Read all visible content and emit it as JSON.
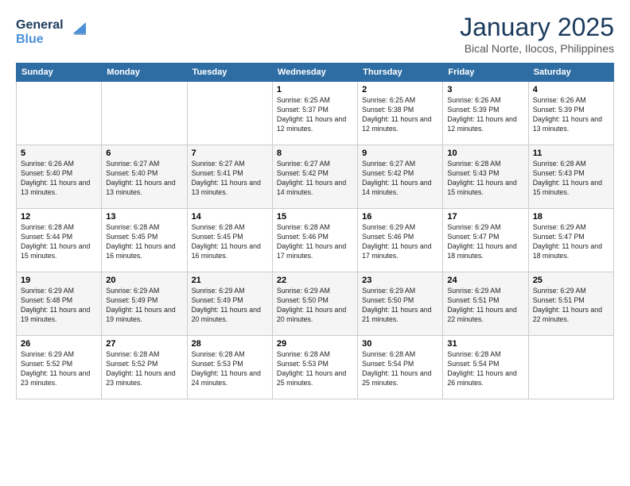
{
  "header": {
    "logo_line1": "General",
    "logo_line2": "Blue",
    "month": "January 2025",
    "location": "Bical Norte, Ilocos, Philippines"
  },
  "weekdays": [
    "Sunday",
    "Monday",
    "Tuesday",
    "Wednesday",
    "Thursday",
    "Friday",
    "Saturday"
  ],
  "weeks": [
    [
      {
        "day": "",
        "sunrise": "",
        "sunset": "",
        "daylight": ""
      },
      {
        "day": "",
        "sunrise": "",
        "sunset": "",
        "daylight": ""
      },
      {
        "day": "",
        "sunrise": "",
        "sunset": "",
        "daylight": ""
      },
      {
        "day": "1",
        "sunrise": "Sunrise: 6:25 AM",
        "sunset": "Sunset: 5:37 PM",
        "daylight": "Daylight: 11 hours and 12 minutes."
      },
      {
        "day": "2",
        "sunrise": "Sunrise: 6:25 AM",
        "sunset": "Sunset: 5:38 PM",
        "daylight": "Daylight: 11 hours and 12 minutes."
      },
      {
        "day": "3",
        "sunrise": "Sunrise: 6:26 AM",
        "sunset": "Sunset: 5:39 PM",
        "daylight": "Daylight: 11 hours and 12 minutes."
      },
      {
        "day": "4",
        "sunrise": "Sunrise: 6:26 AM",
        "sunset": "Sunset: 5:39 PM",
        "daylight": "Daylight: 11 hours and 13 minutes."
      }
    ],
    [
      {
        "day": "5",
        "sunrise": "Sunrise: 6:26 AM",
        "sunset": "Sunset: 5:40 PM",
        "daylight": "Daylight: 11 hours and 13 minutes."
      },
      {
        "day": "6",
        "sunrise": "Sunrise: 6:27 AM",
        "sunset": "Sunset: 5:40 PM",
        "daylight": "Daylight: 11 hours and 13 minutes."
      },
      {
        "day": "7",
        "sunrise": "Sunrise: 6:27 AM",
        "sunset": "Sunset: 5:41 PM",
        "daylight": "Daylight: 11 hours and 13 minutes."
      },
      {
        "day": "8",
        "sunrise": "Sunrise: 6:27 AM",
        "sunset": "Sunset: 5:42 PM",
        "daylight": "Daylight: 11 hours and 14 minutes."
      },
      {
        "day": "9",
        "sunrise": "Sunrise: 6:27 AM",
        "sunset": "Sunset: 5:42 PM",
        "daylight": "Daylight: 11 hours and 14 minutes."
      },
      {
        "day": "10",
        "sunrise": "Sunrise: 6:28 AM",
        "sunset": "Sunset: 5:43 PM",
        "daylight": "Daylight: 11 hours and 15 minutes."
      },
      {
        "day": "11",
        "sunrise": "Sunrise: 6:28 AM",
        "sunset": "Sunset: 5:43 PM",
        "daylight": "Daylight: 11 hours and 15 minutes."
      }
    ],
    [
      {
        "day": "12",
        "sunrise": "Sunrise: 6:28 AM",
        "sunset": "Sunset: 5:44 PM",
        "daylight": "Daylight: 11 hours and 15 minutes."
      },
      {
        "day": "13",
        "sunrise": "Sunrise: 6:28 AM",
        "sunset": "Sunset: 5:45 PM",
        "daylight": "Daylight: 11 hours and 16 minutes."
      },
      {
        "day": "14",
        "sunrise": "Sunrise: 6:28 AM",
        "sunset": "Sunset: 5:45 PM",
        "daylight": "Daylight: 11 hours and 16 minutes."
      },
      {
        "day": "15",
        "sunrise": "Sunrise: 6:28 AM",
        "sunset": "Sunset: 5:46 PM",
        "daylight": "Daylight: 11 hours and 17 minutes."
      },
      {
        "day": "16",
        "sunrise": "Sunrise: 6:29 AM",
        "sunset": "Sunset: 5:46 PM",
        "daylight": "Daylight: 11 hours and 17 minutes."
      },
      {
        "day": "17",
        "sunrise": "Sunrise: 6:29 AM",
        "sunset": "Sunset: 5:47 PM",
        "daylight": "Daylight: 11 hours and 18 minutes."
      },
      {
        "day": "18",
        "sunrise": "Sunrise: 6:29 AM",
        "sunset": "Sunset: 5:47 PM",
        "daylight": "Daylight: 11 hours and 18 minutes."
      }
    ],
    [
      {
        "day": "19",
        "sunrise": "Sunrise: 6:29 AM",
        "sunset": "Sunset: 5:48 PM",
        "daylight": "Daylight: 11 hours and 19 minutes."
      },
      {
        "day": "20",
        "sunrise": "Sunrise: 6:29 AM",
        "sunset": "Sunset: 5:49 PM",
        "daylight": "Daylight: 11 hours and 19 minutes."
      },
      {
        "day": "21",
        "sunrise": "Sunrise: 6:29 AM",
        "sunset": "Sunset: 5:49 PM",
        "daylight": "Daylight: 11 hours and 20 minutes."
      },
      {
        "day": "22",
        "sunrise": "Sunrise: 6:29 AM",
        "sunset": "Sunset: 5:50 PM",
        "daylight": "Daylight: 11 hours and 20 minutes."
      },
      {
        "day": "23",
        "sunrise": "Sunrise: 6:29 AM",
        "sunset": "Sunset: 5:50 PM",
        "daylight": "Daylight: 11 hours and 21 minutes."
      },
      {
        "day": "24",
        "sunrise": "Sunrise: 6:29 AM",
        "sunset": "Sunset: 5:51 PM",
        "daylight": "Daylight: 11 hours and 22 minutes."
      },
      {
        "day": "25",
        "sunrise": "Sunrise: 6:29 AM",
        "sunset": "Sunset: 5:51 PM",
        "daylight": "Daylight: 11 hours and 22 minutes."
      }
    ],
    [
      {
        "day": "26",
        "sunrise": "Sunrise: 6:29 AM",
        "sunset": "Sunset: 5:52 PM",
        "daylight": "Daylight: 11 hours and 23 minutes."
      },
      {
        "day": "27",
        "sunrise": "Sunrise: 6:28 AM",
        "sunset": "Sunset: 5:52 PM",
        "daylight": "Daylight: 11 hours and 23 minutes."
      },
      {
        "day": "28",
        "sunrise": "Sunrise: 6:28 AM",
        "sunset": "Sunset: 5:53 PM",
        "daylight": "Daylight: 11 hours and 24 minutes."
      },
      {
        "day": "29",
        "sunrise": "Sunrise: 6:28 AM",
        "sunset": "Sunset: 5:53 PM",
        "daylight": "Daylight: 11 hours and 25 minutes."
      },
      {
        "day": "30",
        "sunrise": "Sunrise: 6:28 AM",
        "sunset": "Sunset: 5:54 PM",
        "daylight": "Daylight: 11 hours and 25 minutes."
      },
      {
        "day": "31",
        "sunrise": "Sunrise: 6:28 AM",
        "sunset": "Sunset: 5:54 PM",
        "daylight": "Daylight: 11 hours and 26 minutes."
      },
      {
        "day": "",
        "sunrise": "",
        "sunset": "",
        "daylight": ""
      }
    ]
  ]
}
